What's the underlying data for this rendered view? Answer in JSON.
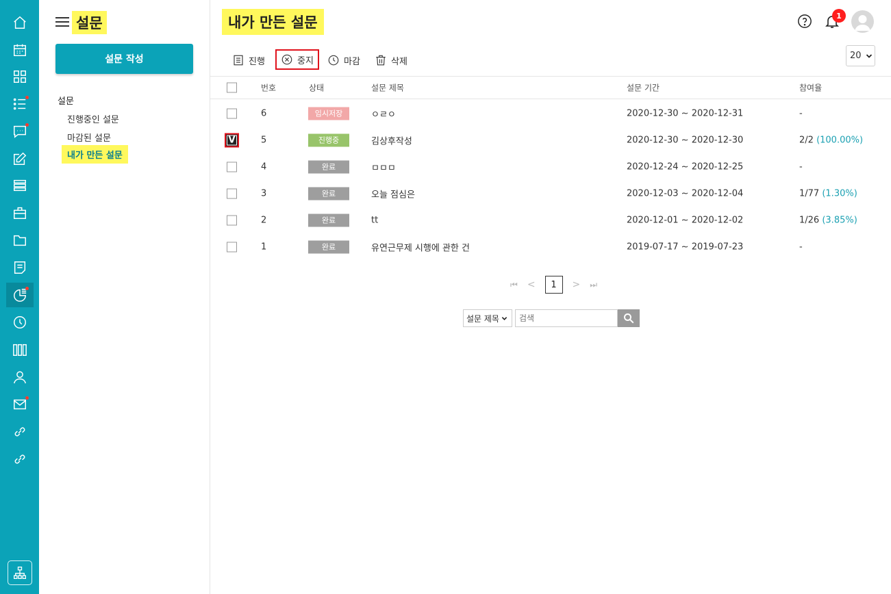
{
  "sidebar": {
    "title": "설문",
    "compose_label": "설문 작성",
    "group_label": "설문",
    "items": [
      {
        "label": "진행중인 설문"
      },
      {
        "label": "마감된 설문"
      },
      {
        "label": "내가 만든 설문"
      }
    ]
  },
  "rail": {
    "icons": [
      "home-icon",
      "calendar-icon",
      "grid-icon",
      "list-icon",
      "chat-icon",
      "edit-icon",
      "stack-icon",
      "briefcase-icon",
      "folder-icon",
      "note-icon",
      "survey-icon",
      "clock-icon",
      "books-icon",
      "user-icon",
      "mail-icon",
      "link-icon",
      "link-icon",
      "org-chart-icon"
    ],
    "accent": "#0ba3b8"
  },
  "header": {
    "title": "내가 만든 설문",
    "notification_count": "1"
  },
  "toolbar": {
    "progress_label": "진행",
    "stop_label": "중지",
    "close_label": "마감",
    "delete_label": "삭제",
    "page_size": "20"
  },
  "table": {
    "columns": {
      "no": "번호",
      "status": "상태",
      "title": "설문 제목",
      "period": "설문 기간",
      "rate": "참여율"
    },
    "rows": [
      {
        "no": "6",
        "status": "임시저장",
        "status_color": "#f2a8a8",
        "title": "ㅇㄹㅇ",
        "period": "2020-12-30 ~ 2020-12-31",
        "rate": "-",
        "rate_pct": "",
        "checked": false
      },
      {
        "no": "5",
        "status": "진행중",
        "status_color": "#98c46a",
        "title": "김상후작성",
        "period": "2020-12-30 ~ 2020-12-30",
        "rate": "2/2",
        "rate_pct": "(100.00%)",
        "checked": true
      },
      {
        "no": "4",
        "status": "완료",
        "status_color": "#9e9e9e",
        "title": "ㅁㅁㅁ",
        "period": "2020-12-24 ~ 2020-12-25",
        "rate": "-",
        "rate_pct": "",
        "checked": false
      },
      {
        "no": "3",
        "status": "완료",
        "status_color": "#9e9e9e",
        "title": "오늘 점심은",
        "period": "2020-12-03 ~ 2020-12-04",
        "rate": "1/77",
        "rate_pct": "(1.30%)",
        "checked": false
      },
      {
        "no": "2",
        "status": "완료",
        "status_color": "#9e9e9e",
        "title": "tt",
        "period": "2020-12-01 ~ 2020-12-02",
        "rate": "1/26",
        "rate_pct": "(3.85%)",
        "checked": false
      },
      {
        "no": "1",
        "status": "완료",
        "status_color": "#9e9e9e",
        "title": "유연근무제 시행에 관한 건",
        "period": "2019-07-17 ~ 2019-07-23",
        "rate": "-",
        "rate_pct": "",
        "checked": false
      }
    ]
  },
  "pagination": {
    "current": "1"
  },
  "search": {
    "field": "설문 제목",
    "placeholder": "검색"
  }
}
